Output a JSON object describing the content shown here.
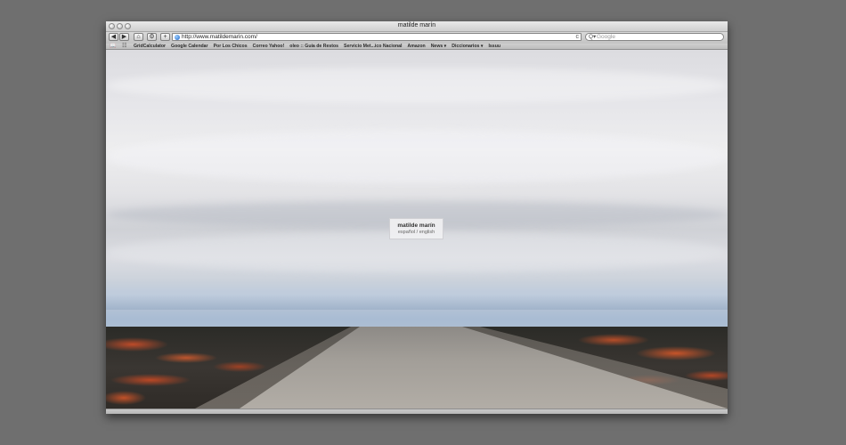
{
  "window": {
    "title": "matilde marín"
  },
  "toolbar": {
    "back_icon": "◀",
    "forward_icon": "▶",
    "home_icon": "⌂",
    "settings_icon": "⚙",
    "add_bookmark_icon": "+",
    "url": "http://www.matildemarin.com/",
    "reload_icon": "c",
    "search_icon": "Q▾",
    "search_placeholder": "Google"
  },
  "bookmarks": {
    "book_icon": "📖",
    "grid_icon": "☷",
    "items": [
      {
        "label": "GridCalculator"
      },
      {
        "label": "Google Calendar"
      },
      {
        "label": "Por Los Chicos"
      },
      {
        "label": "Correo Yahoo!"
      },
      {
        "label": "oleo :: Guía de Restos"
      },
      {
        "label": "Servicio Met...ico Nacional"
      },
      {
        "label": "Amazon"
      },
      {
        "label": "News ▾"
      },
      {
        "label": "Diccionarios ▾"
      },
      {
        "label": "Issuu"
      }
    ]
  },
  "page": {
    "site_name": "matilde marín",
    "lang_es": "español",
    "lang_separator": " / ",
    "lang_en": "english"
  }
}
